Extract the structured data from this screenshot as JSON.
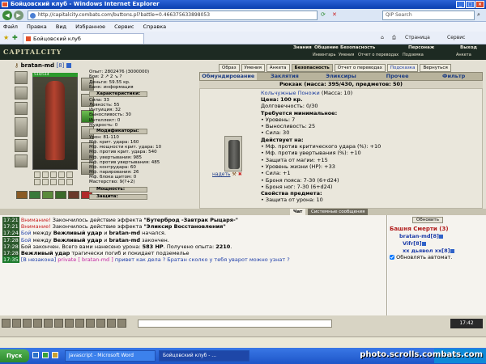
{
  "window": {
    "title": "Бойцовский клуб - Windows Internet Explorer"
  },
  "browser": {
    "url": "http://capitalcity.combats.com/buttons.pl?battle=0.466375633898053",
    "search_placeholder": "QIP Search",
    "menu": [
      "Файл",
      "Правка",
      "Вид",
      "Избранное",
      "Сервис",
      "Справка"
    ],
    "tab_title": "Бойцовский клуб",
    "toolbar_page": "Страница",
    "toolbar_service": "Сервис"
  },
  "game": {
    "logo": "CAPITALCITY",
    "top_menu": [
      "Знания",
      "Общение",
      "Безопасность",
      "Персонаж",
      "Выход"
    ],
    "sub_menu": [
      "Инвентарь",
      "Умения",
      "Отчет о переводах",
      "Подземка",
      "Анкета"
    ]
  },
  "character": {
    "name": "bratan-md",
    "level": "[8]",
    "hp": "514/514",
    "experience": "Опыт: 2802476 (3000000)",
    "battles": "Бои: 2 ↗ 2 ↘ ?",
    "money": "Деньги: 59.55 кр.",
    "bank": "Банк: информация",
    "sections": {
      "characteristics": "Характеристики:",
      "modifiers": "Модификаторы:",
      "power": "Мощность:",
      "protection": "Защита:"
    },
    "stats": [
      "Сила: 33",
      "Ловкость: 55",
      "Интуиция: 32",
      "Выносливость: 30",
      "Интеллект: 0",
      "Мудрость: 0"
    ],
    "modifiers": [
      "Урон: 81-110",
      "Мф. крит. удара: 160",
      "Мф. мощности крит. удара: 10",
      "Мф. против крит. удара: 540",
      "Мф. увертывания: 985",
      "Мф. против увертывания: 485",
      "Мф. контрудара: 60",
      "Мф. парирования: 26",
      "Мф. блока щитом: 0",
      "Мастерство: 9(?+2)"
    ]
  },
  "inventory": {
    "buttons": [
      "Образ",
      "Умения",
      "Анкета",
      "Безопасность",
      "Отчет о переводах",
      "Подсказка",
      "Вернуться"
    ],
    "tabs": [
      "Обмундирование",
      "Заклятия",
      "Эликсиры",
      "Прочее",
      "Фильтр"
    ],
    "header": "Рюкзак (масса: 395/430, предметов: 50)",
    "put_on": "надеть",
    "item": {
      "name": "Кольчужные Поножи",
      "mass": "(Масса: 10)",
      "lines": [
        {
          "text": "Цена: 100 кр.",
          "bold": true
        },
        {
          "text": "Долговечность: 0/30",
          "bold": false
        },
        {
          "text": "Требуется минимальное:",
          "bold": true
        },
        {
          "text": "• Уровень: 7",
          "bold": false
        },
        {
          "text": "• Выносливость: 25",
          "bold": false
        },
        {
          "text": "• Сила: 30",
          "bold": false
        },
        {
          "text": "Действует на:",
          "bold": true
        },
        {
          "text": "• Мф. против критического удара (%): +10",
          "bold": false
        },
        {
          "text": "• Мф. против увертывания (%): +10",
          "bold": false
        },
        {
          "text": "• Защита от магии: +15",
          "bold": false
        },
        {
          "text": "• Уровень жизни (HP): +33",
          "bold": false
        },
        {
          "text": "• Сила: +1",
          "bold": false
        },
        {
          "text": "• Броня пояса: 7-30 (6+d24)",
          "bold": false
        },
        {
          "text": "• Броня ног: 7-30 (6+d24)",
          "bold": false
        },
        {
          "text": "Свойства предмета:",
          "bold": true
        },
        {
          "text": "• Защита от урона: 10",
          "bold": false
        }
      ]
    }
  },
  "chat": {
    "tabs": [
      "Чат",
      "Системные сообщения"
    ],
    "lines": [
      {
        "time": "17:21",
        "parts": [
          {
            "t": "Внимание!",
            "c": "warn"
          },
          {
            "t": " Закончилось действие эффекта ",
            "c": ""
          },
          {
            "t": "\"Бутерброд -Завтрак Рыцаря-\"",
            "c": "b"
          }
        ]
      },
      {
        "time": "17:21",
        "parts": [
          {
            "t": "Внимание!",
            "c": "warn"
          },
          {
            "t": " Закончилось действие эффекта ",
            "c": ""
          },
          {
            "t": "\"Эликсир Восстановления\"",
            "c": "b"
          }
        ]
      },
      {
        "time": "17:24",
        "parts": [
          {
            "t": "Бой",
            "c": "blue"
          },
          {
            "t": " между ",
            "c": ""
          },
          {
            "t": "Вежливый удар",
            "c": "b"
          },
          {
            "t": " и ",
            "c": ""
          },
          {
            "t": "bratan-md",
            "c": "b"
          },
          {
            "t": " начался.",
            "c": ""
          }
        ]
      },
      {
        "time": "17:28",
        "parts": [
          {
            "t": "Бой",
            "c": "blue"
          },
          {
            "t": " между ",
            "c": ""
          },
          {
            "t": "Вежливый удар",
            "c": "b"
          },
          {
            "t": " и ",
            "c": ""
          },
          {
            "t": "bratan-md",
            "c": "b"
          },
          {
            "t": " закончен.",
            "c": ""
          }
        ]
      },
      {
        "time": "17:28",
        "parts": [
          {
            "t": "Бой закончен. Всего вами нанесено урона: ",
            "c": ""
          },
          {
            "t": "583 HP",
            "c": "b"
          },
          {
            "t": ". Получено опыта: ",
            "c": ""
          },
          {
            "t": "2210",
            "c": "b"
          },
          {
            "t": ".",
            "c": ""
          }
        ]
      },
      {
        "time": "17:28",
        "parts": [
          {
            "t": "Вежливый удар",
            "c": "b"
          },
          {
            "t": " трагически погиб и покидает подземелье",
            "c": ""
          }
        ]
      },
      {
        "time": "17:35",
        "parts": [
          {
            "t": "[В незакона]",
            "c": "blue"
          },
          {
            "t": " private [ bratan-md ]",
            "c": "priv"
          },
          {
            "t": " привет как дела ? Братан сколко у тебя уварот можно узнат ?",
            "c": "blue"
          }
        ]
      }
    ]
  },
  "room": {
    "refresh": "Обновить",
    "title": "Башня Смерти (3)",
    "players": [
      {
        "name": "bratan-md",
        "level": "[8]"
      },
      {
        "name": "Vifr",
        "level": "[8]"
      },
      {
        "name": "xx дьявол xx",
        "level": "[8]"
      }
    ],
    "auto_refresh": "Обновлять автомат."
  },
  "taskbar": {
    "start": "Пуск",
    "items": [
      "javascript - Microsoft Word",
      "Бойцовский клуб - ..."
    ],
    "clock": "17:42"
  },
  "watermark": "photo.scrolls.combats.com"
}
